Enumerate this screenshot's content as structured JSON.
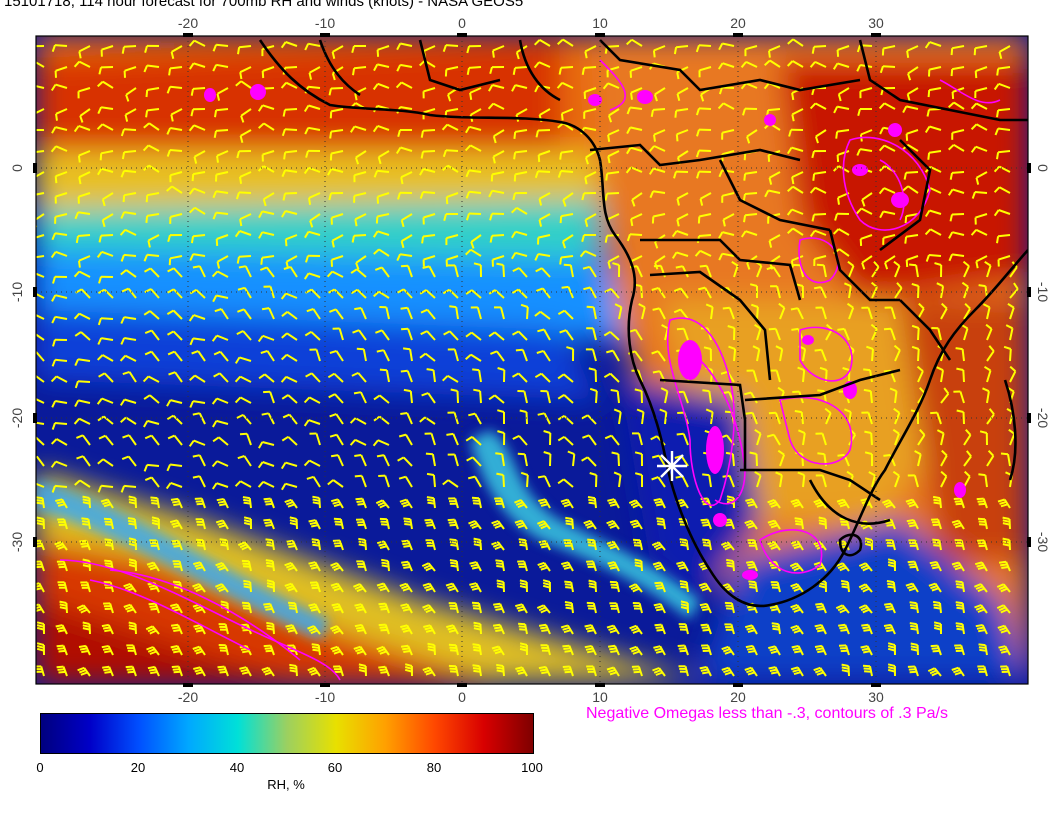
{
  "title": "15101718, 114 hour forecast for 700mb RH and winds (knots) - NASA GEOS5",
  "map": {
    "lon_ticks": [
      "-20",
      "-10",
      "0",
      "10",
      "20",
      "30"
    ],
    "lat_ticks": [
      "0",
      "-10",
      "-20",
      "-30"
    ],
    "marker": "white-star-icon",
    "colors": {
      "barbs": "#ffff00",
      "omega_contours": "#ff00ff",
      "coastlines": "#000000",
      "marker": "#ffffff"
    }
  },
  "omega_note": "Negative Omegas less than -.3, contours of .3 Pa/s",
  "colorbar": {
    "labels": [
      "0",
      "20",
      "40",
      "60",
      "80",
      "100"
    ],
    "title": "RH, %"
  }
}
